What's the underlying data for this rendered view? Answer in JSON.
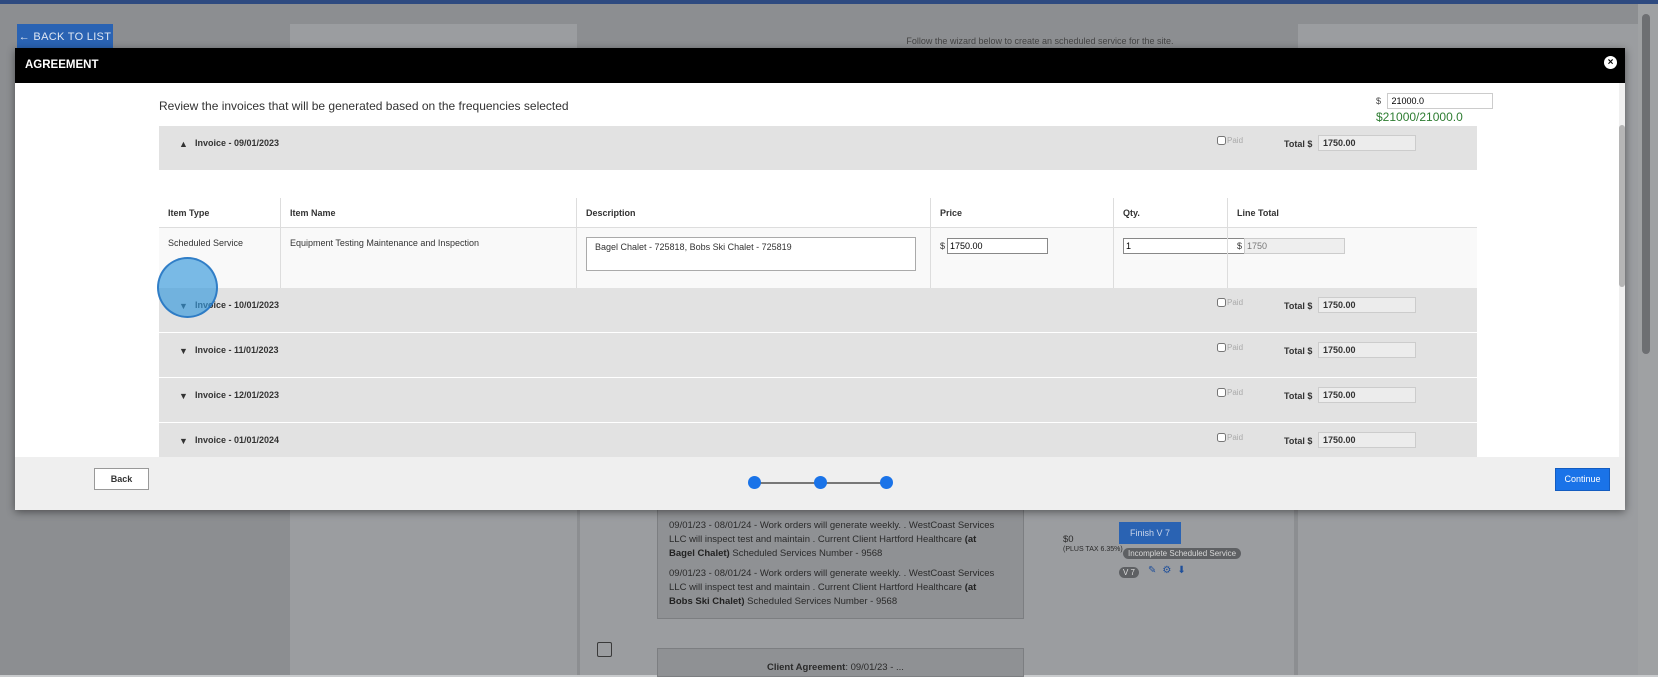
{
  "background": {
    "back_to_list": "← BACK TO LIST",
    "wizard_note": "Follow the wizard below to create an scheduled service for the site.",
    "entry1": {
      "text": "09/01/23 - 08/01/24 - Work orders will generate weekly. . WestCoast Services LLC will inspect test and maintain . Current Client Hartford Healthcare",
      "bold": "(at Bagel Chalet)",
      "tail": "Scheduled Services Number - 9568"
    },
    "entry2": {
      "text": "09/01/23 - 08/01/24 - Work orders will generate weekly. . WestCoast Services LLC will inspect test and maintain . Current Client Hartford Healthcare",
      "bold": "(at Bobs Ski Chalet)",
      "tail": "Scheduled Services Number - 9568"
    },
    "price": "$0",
    "price_note": "(PLUS TAX 6.35%)",
    "finish_label": "Finish V 7",
    "incomplete_badge": "Incomplete Scheduled Service",
    "version_badge": "V 7",
    "client_agreement_label": "Client Agreement",
    "client_agreement_value": ": 09/01/23 - ..."
  },
  "modal": {
    "title": "AGREEMENT",
    "review_text": "Review the invoices that will be generated based on the frequencies selected",
    "amount_prefix": "$",
    "amount_value": "21000.0",
    "amount_summary": "$21000/21000.0",
    "paid_label": "Paid",
    "total_label": "Total $",
    "table": {
      "headers": [
        "Item Type",
        "Item Name",
        "Description",
        "Price",
        "Qty.",
        "Line Total"
      ],
      "row": {
        "item_type": "Scheduled Service",
        "item_name": "Equipment Testing Maintenance and Inspection",
        "description": "Bagel Chalet - 725818, Bobs Ski Chalet - 725819",
        "price_prefix": "$",
        "price": "1750.00",
        "qty": "1",
        "line_total_prefix": "$",
        "line_total": "1750"
      }
    },
    "invoices": [
      {
        "label": "Invoice - 09/01/2023",
        "total": "1750.00",
        "expanded": true
      },
      {
        "label": "Invoice - 10/01/2023",
        "total": "1750.00",
        "expanded": false
      },
      {
        "label": "Invoice - 11/01/2023",
        "total": "1750.00",
        "expanded": false
      },
      {
        "label": "Invoice - 12/01/2023",
        "total": "1750.00",
        "expanded": false
      },
      {
        "label": "Invoice - 01/01/2024",
        "total": "1750.00",
        "expanded": false
      }
    ],
    "back_label": "Back",
    "continue_label": "Continue"
  },
  "colors": {
    "accent": "#1a73e8",
    "success": "#2e7d32",
    "header_bg": "#000000"
  }
}
